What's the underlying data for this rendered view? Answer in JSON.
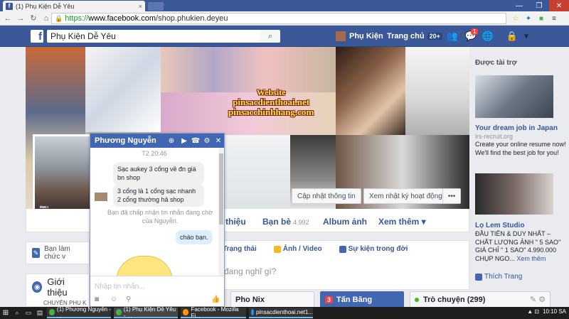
{
  "browser": {
    "tab_title": "(1) Phụ Kiện Dễ Yêu",
    "tab_close": "×",
    "url_scheme": "https://",
    "url_host": "www.facebook.com",
    "url_path": "/shop.phukien.deyeu",
    "window_controls": [
      "—",
      "❐",
      "✕"
    ]
  },
  "fb": {
    "search_value": "Phụ Kiện Dễ Yêu",
    "user_name": "Phụ Kiện",
    "home_label": "Trang chủ",
    "home_count": "20+",
    "notification_count": "1"
  },
  "cover": {
    "website_line1": "Website",
    "website_line2": "pinsacdienthoai.net",
    "website_line3": "pinsacchinhhang.com",
    "btn_update_info": "Cập nhật thông tin",
    "btn_activity_log": "Xem nhật ký hoạt động",
    "btn_more": "•••"
  },
  "pagenav": {
    "about": "thiệu",
    "friends": "Bạn bè",
    "friends_count": "4.992",
    "photos": "Album ảnh",
    "more": "Xem thêm ▾"
  },
  "left": {
    "status_prompt": "Bạn làm chức v",
    "intro_title": "Giới thiệu",
    "intro_clip": "CHUYÊN PHU K"
  },
  "composer": {
    "tab_status": "Trạng thái",
    "tab_photo": "Ảnh / Video",
    "tab_event": "Sự kiện trong đời",
    "placeholder": "đang nghĩ gì?"
  },
  "chat": {
    "contact_name": "Phương Nguyễn",
    "timestamp": "T2 20:46",
    "msg1": "Sạc aukey 3 cổng về đn giá bn shop",
    "msg2": "3 cổng là 1 cổng sạc nhanh 2 cổng thường hả shop",
    "system_msg": "Bạn đã chấp nhận tin nhắn đang chờ của Nguyễn.",
    "my_msg": "chào bạn.",
    "input_placeholder": "Nhập tin nhắn..."
  },
  "sidebar": {
    "sponsored": "Được tài trợ",
    "ad1_title": "Your dream job in Japan",
    "ad1_domain": "irs-recruit.org",
    "ad1_body": "Create your online resume now! We'll find the best job for you!",
    "ad2_title": "Lọ Lem Studio",
    "ad2_body": "ĐẦU TIÊN & DUY NHẤT – CHẤT LƯỢNG ẢNH \" 5 SAO\" GIÁ CHỈ \" 1 SAO\" 4.990.000 CHỤP NGO...",
    "ad2_more": "Xem thêm",
    "like_page": "Thích Trang"
  },
  "chat_tabs": {
    "tab1": "Pho Nix",
    "tab2_badge": "3",
    "tab2": "Tấn Băng",
    "tab3": "Trò chuyện (299)"
  },
  "taskbar": {
    "item1": "(1) Phương Nguyễn - ...",
    "item2": "(1) Phụ Kiện Dễ Yêu - ...",
    "item3": "Facebook - Mozilla Fi...",
    "item4": "pinsacdienthoai.net1...",
    "clock": "10:10 SA"
  }
}
